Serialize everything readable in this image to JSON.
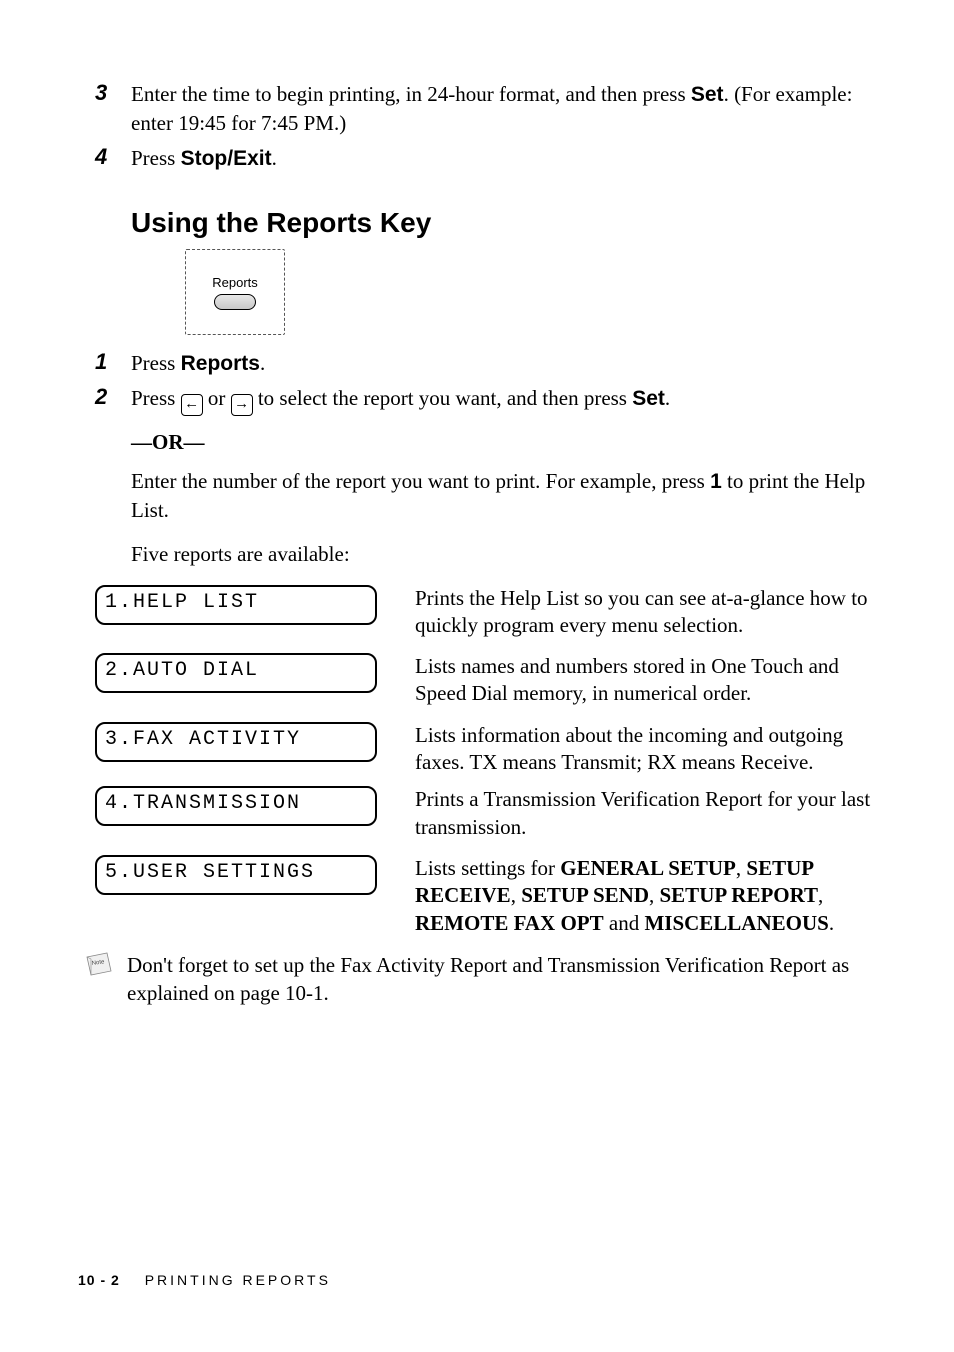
{
  "steps_top": [
    {
      "num": "3",
      "parts": [
        {
          "t": "Enter the time to begin printing, in 24-hour format, and then press "
        },
        {
          "t": "Set",
          "strong": true
        },
        {
          "t": ". (For example: enter 19:45 for 7:45 PM.)"
        }
      ]
    },
    {
      "num": "4",
      "parts": [
        {
          "t": "Press "
        },
        {
          "t": "Stop/Exit",
          "strong": true
        },
        {
          "t": "."
        }
      ]
    }
  ],
  "section_title": "Using the Reports Key",
  "reports_button_label": "Reports",
  "steps_mid": {
    "s1": {
      "num": "1",
      "pre": "Press ",
      "strong": "Reports",
      "post": "."
    },
    "s2": {
      "num": "2",
      "pre": "Press ",
      "mid": " or ",
      "post1": " to select the report you want, and then press ",
      "strong": "Set",
      "post2": "."
    }
  },
  "or_text": "—OR—",
  "enter_number": {
    "pre": "Enter the number of the report you want to print. For example, press ",
    "strong": "1",
    "post": " to print the Help List."
  },
  "five_available": "Five reports are available:",
  "reports": [
    {
      "lcd": "1.HELP LIST",
      "desc": "Prints the Help List so you can see at-a-glance how to quickly program every menu selection."
    },
    {
      "lcd": "2.AUTO DIAL",
      "desc": "Lists names and numbers stored in One Touch and Speed Dial memory, in numerical order."
    },
    {
      "lcd": "3.FAX ACTIVITY",
      "desc": "Lists information about the incoming and outgoing faxes. TX means Transmit; RX means Receive."
    },
    {
      "lcd": "4.TRANSMISSION",
      "desc": "Prints a Transmission Verification Report for your last transmission."
    },
    {
      "lcd": "5.USER SETTINGS",
      "desc_pre": "Lists settings for ",
      "caps": [
        "GENERAL SETUP",
        "SETUP RECEIVE",
        "SETUP SEND",
        "SETUP REPORT",
        "REMOTE FAX OPT",
        "MISCELLANEOUS"
      ],
      "joins": [
        ", ",
        ", ",
        ", ",
        ", ",
        " and ",
        "."
      ]
    }
  ],
  "note_label": "Note",
  "note_text": "Don't forget to set up the Fax Activity Report and Transmission Verification Report as explained on page 10-1.",
  "footer": {
    "page": "10 - 2",
    "title": "PRINTING REPORTS"
  }
}
